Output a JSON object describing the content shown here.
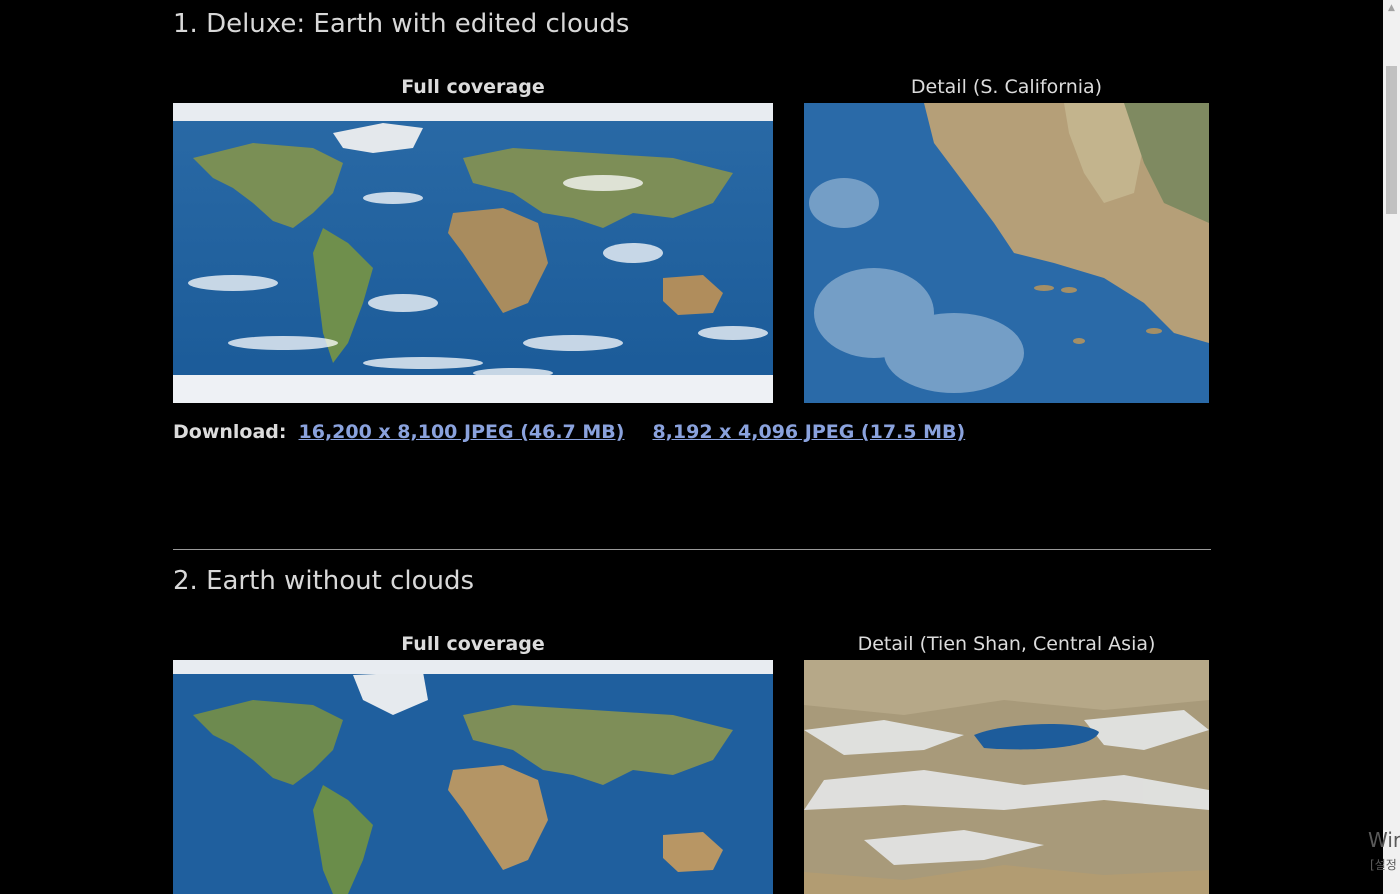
{
  "sections": [
    {
      "heading": "1. Deluxe: Earth with edited clouds",
      "full_caption": "Full coverage",
      "detail_caption": "Detail (S. California)",
      "download": {
        "label": "Download:",
        "links": [
          "16,200 x 8,100 JPEG (46.7 MB)",
          "8,192 x 4,096 JPEG (17.5 MB)"
        ]
      }
    },
    {
      "heading": "2. Earth without clouds",
      "full_caption": "Full coverage",
      "detail_caption": "Detail (Tien Shan, Central Asia)"
    }
  ],
  "images": {
    "full_1": "world-map-with-clouds",
    "detail_1": "southern-california-detail",
    "full_2": "world-map-no-clouds",
    "detail_2": "tien-shan-detail"
  },
  "colors": {
    "background": "#000000",
    "text": "#d8d8d8",
    "link": "#8aa2dd",
    "ocean": "#1c5f9c",
    "land_green": "#6b8a4a",
    "land_tan": "#b89a6e",
    "ice": "#e8ecf0"
  },
  "watermark": {
    "line1": "Wir",
    "line2": "[설정"
  }
}
